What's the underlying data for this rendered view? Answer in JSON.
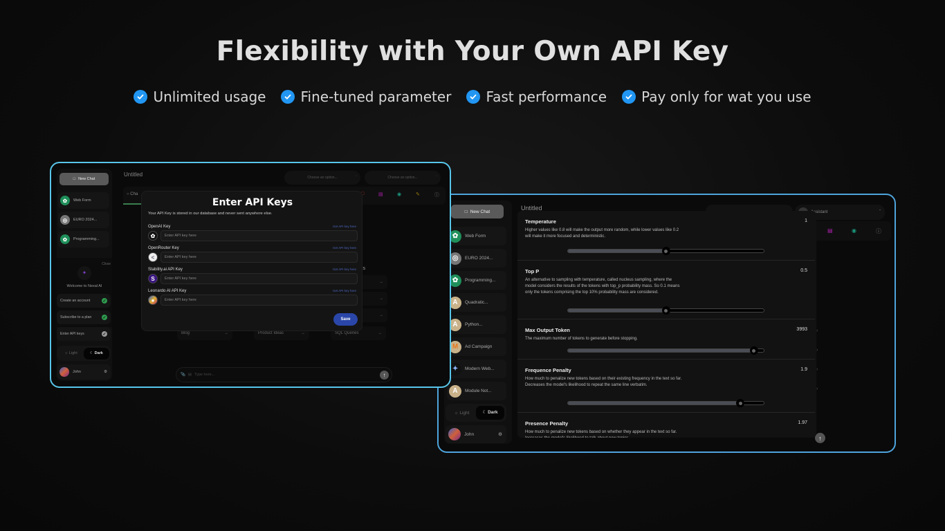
{
  "headline": "Flexibility with Your Own API Key",
  "features": [
    "Unlimited usage",
    "Fine-tuned parameter",
    "Fast performance",
    "Pay only for wat you use"
  ],
  "colors": {
    "check": "#2196f3",
    "panel1_border": "#58c6ea",
    "panel2_border": "#4ea4dc",
    "save": "#2a46a8",
    "accent_green": "#1f8f5a"
  },
  "left_app": {
    "new_chat": "New Chat",
    "chats": [
      {
        "label": "Web Form",
        "icon": "openai-icon"
      },
      {
        "label": "EURO 2024...",
        "icon": "globe-icon"
      },
      {
        "label": "Programming...",
        "icon": "openai-icon"
      }
    ],
    "welcome": {
      "close": "Close",
      "title": "Welcome to Nexal AI",
      "steps": [
        {
          "label": "Create an account",
          "done": true
        },
        {
          "label": "Subscribe to a plan",
          "done": true
        },
        {
          "label": "Enter API keys",
          "done": false
        }
      ]
    },
    "theme": {
      "light": "Light",
      "dark": "Dark",
      "selected": "Dark"
    },
    "user": "John",
    "chat_title": "Untitled",
    "dropdown1": "Choose an option...",
    "dropdown2": "Choose an option...",
    "tab": "Cha",
    "tools_heading": "er Tools",
    "tool_partials": [
      "tant",
      "ation"
    ],
    "prompts": [
      "Blog",
      "Product Ideas",
      "SQL Queries"
    ],
    "input_placeholder": "Type here...",
    "modal": {
      "title": "Enter API Keys",
      "subtitle": "Your API Key is stored in our database and never sent anywhere else.",
      "link": "Get API key here",
      "placeholder": "Enter API key here",
      "keys": [
        {
          "label": "OpenAI Key",
          "icon": "openai-icon"
        },
        {
          "label": "OpenRouter Key",
          "icon": "openrouter-icon"
        },
        {
          "label": "Stability.ai API Key",
          "icon": "stability-icon"
        },
        {
          "label": "Leonardo AI API Key",
          "icon": "leonardo-icon"
        }
      ],
      "save": "Save"
    }
  },
  "right_app": {
    "new_chat": "New Chat",
    "chats": [
      {
        "label": "Web Form",
        "icon": "openai-icon"
      },
      {
        "label": "EURO 2024...",
        "icon": "globe-icon"
      },
      {
        "label": "Programming...",
        "icon": "openai-icon"
      },
      {
        "label": "Quadratic...",
        "icon": "anthropic-icon"
      },
      {
        "label": "Python...",
        "icon": "anthropic-icon"
      },
      {
        "label": "Ad Campaign",
        "icon": "mistral-icon"
      },
      {
        "label": "Modern Web...",
        "icon": "gemini-icon"
      },
      {
        "label": "Module Not...",
        "icon": "anthropic-icon"
      }
    ],
    "theme": {
      "light": "Light",
      "dark": "Dark",
      "selected": "Dark"
    },
    "user": "John",
    "chat_title": "Untitled",
    "assistant_dropdown": "Assistant",
    "settings": [
      {
        "title": "Temperature",
        "value": "1",
        "fraction": 0.5,
        "description": "Higher values like 0.8 will make the output more random, while lower values like 0.2 will make it more focused and deterministic."
      },
      {
        "title": "Top P",
        "value": "0.5",
        "fraction": 0.5,
        "description": "An alternative to sampling with temperature, called nucleus sampling, where the model considers the results of the tokens with top_p probability mass. So 0.1 means only the tokens comprising the top 10% probability mass are considered."
      },
      {
        "title": "Max Output Token",
        "value": "3993",
        "fraction": 0.95,
        "description": "The maximum number of tokens to generate before stopping."
      },
      {
        "title": "Frequence Penalty",
        "value": "1.9",
        "fraction": 0.88,
        "description": "How much to penalize new tokens based on their existing frequency in the text so far. Decreases the model's likelihood to repeat the same line verbatim."
      },
      {
        "title": "Presence Penalty",
        "value": "1.97",
        "description": "How much to penalize new tokens based on whether they appear in the text so far. Increases the model's likelihood to talk about new topics."
      }
    ]
  }
}
